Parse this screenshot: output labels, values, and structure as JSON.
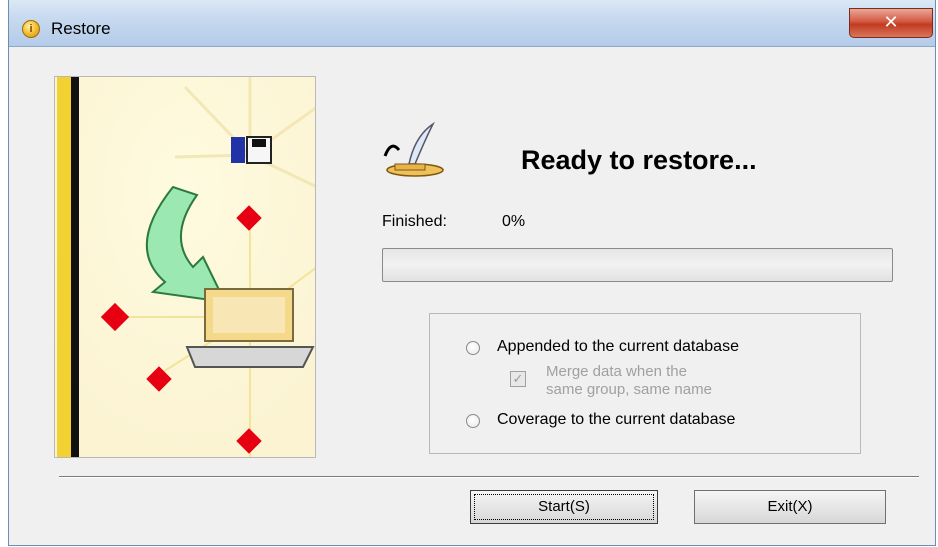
{
  "window": {
    "title": "Restore"
  },
  "main": {
    "heading": "Ready to restore...",
    "finished_label": "Finished:",
    "finished_value": "0%",
    "progress": 0
  },
  "options": {
    "append_label": "Appended to the current database",
    "merge_line1": "Merge data when the",
    "merge_line2": "same group, same name",
    "coverage_label": "Coverage to the current database"
  },
  "buttons": {
    "start_label": "Start(S)",
    "exit_label": "Exit(X)"
  },
  "icons": {
    "app": "info-icon",
    "close": "close-icon",
    "quill": "quill-icon",
    "banner": "restore-banner-illustration"
  },
  "colors": {
    "titlebar": "#c5d8ef",
    "close": "#c13b20",
    "window_bg": "#f0f0f0"
  }
}
